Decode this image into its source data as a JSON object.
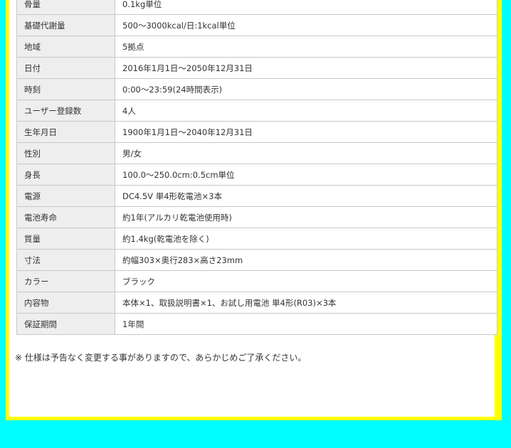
{
  "specs": [
    {
      "label": "骨量",
      "value": "0.1kg単位"
    },
    {
      "label": "基礎代謝量",
      "value": "500～3000kcal/日:1kcal単位"
    },
    {
      "label": "地域",
      "value": "5拠点"
    },
    {
      "label": "日付",
      "value": "2016年1月1日～2050年12月31日"
    },
    {
      "label": "時刻",
      "value": "0:00～23:59(24時間表示)"
    },
    {
      "label": "ユーザー登録数",
      "value": "4人"
    },
    {
      "label": "生年月日",
      "value": "1900年1月1日～2040年12月31日"
    },
    {
      "label": "性別",
      "value": "男/女"
    },
    {
      "label": "身長",
      "value": "100.0～250.0cm:0.5cm単位"
    },
    {
      "label": "電源",
      "value": "DC4.5V 単4形乾電池×3本"
    },
    {
      "label": "電池寿命",
      "value": "約1年(アルカリ乾電池使用時)"
    },
    {
      "label": "質量",
      "value": "約1.4kg(乾電池を除く)"
    },
    {
      "label": "寸法",
      "value": "約幅303×奥行283×高さ23mm"
    },
    {
      "label": "カラー",
      "value": "ブラック"
    },
    {
      "label": "内容物",
      "value": "本体×1、取扱説明書×1、お試し用電池 単4形(R03)×3本"
    },
    {
      "label": "保証期間",
      "value": "1年間"
    }
  ],
  "note": "※ 仕様は予告なく変更する事がありますので、あらかじめご了承ください。",
  "colors": {
    "background": "#00ffff",
    "frame": "#ffff00",
    "label_cell": "#eeeeee",
    "border": "#c8c8c8"
  }
}
